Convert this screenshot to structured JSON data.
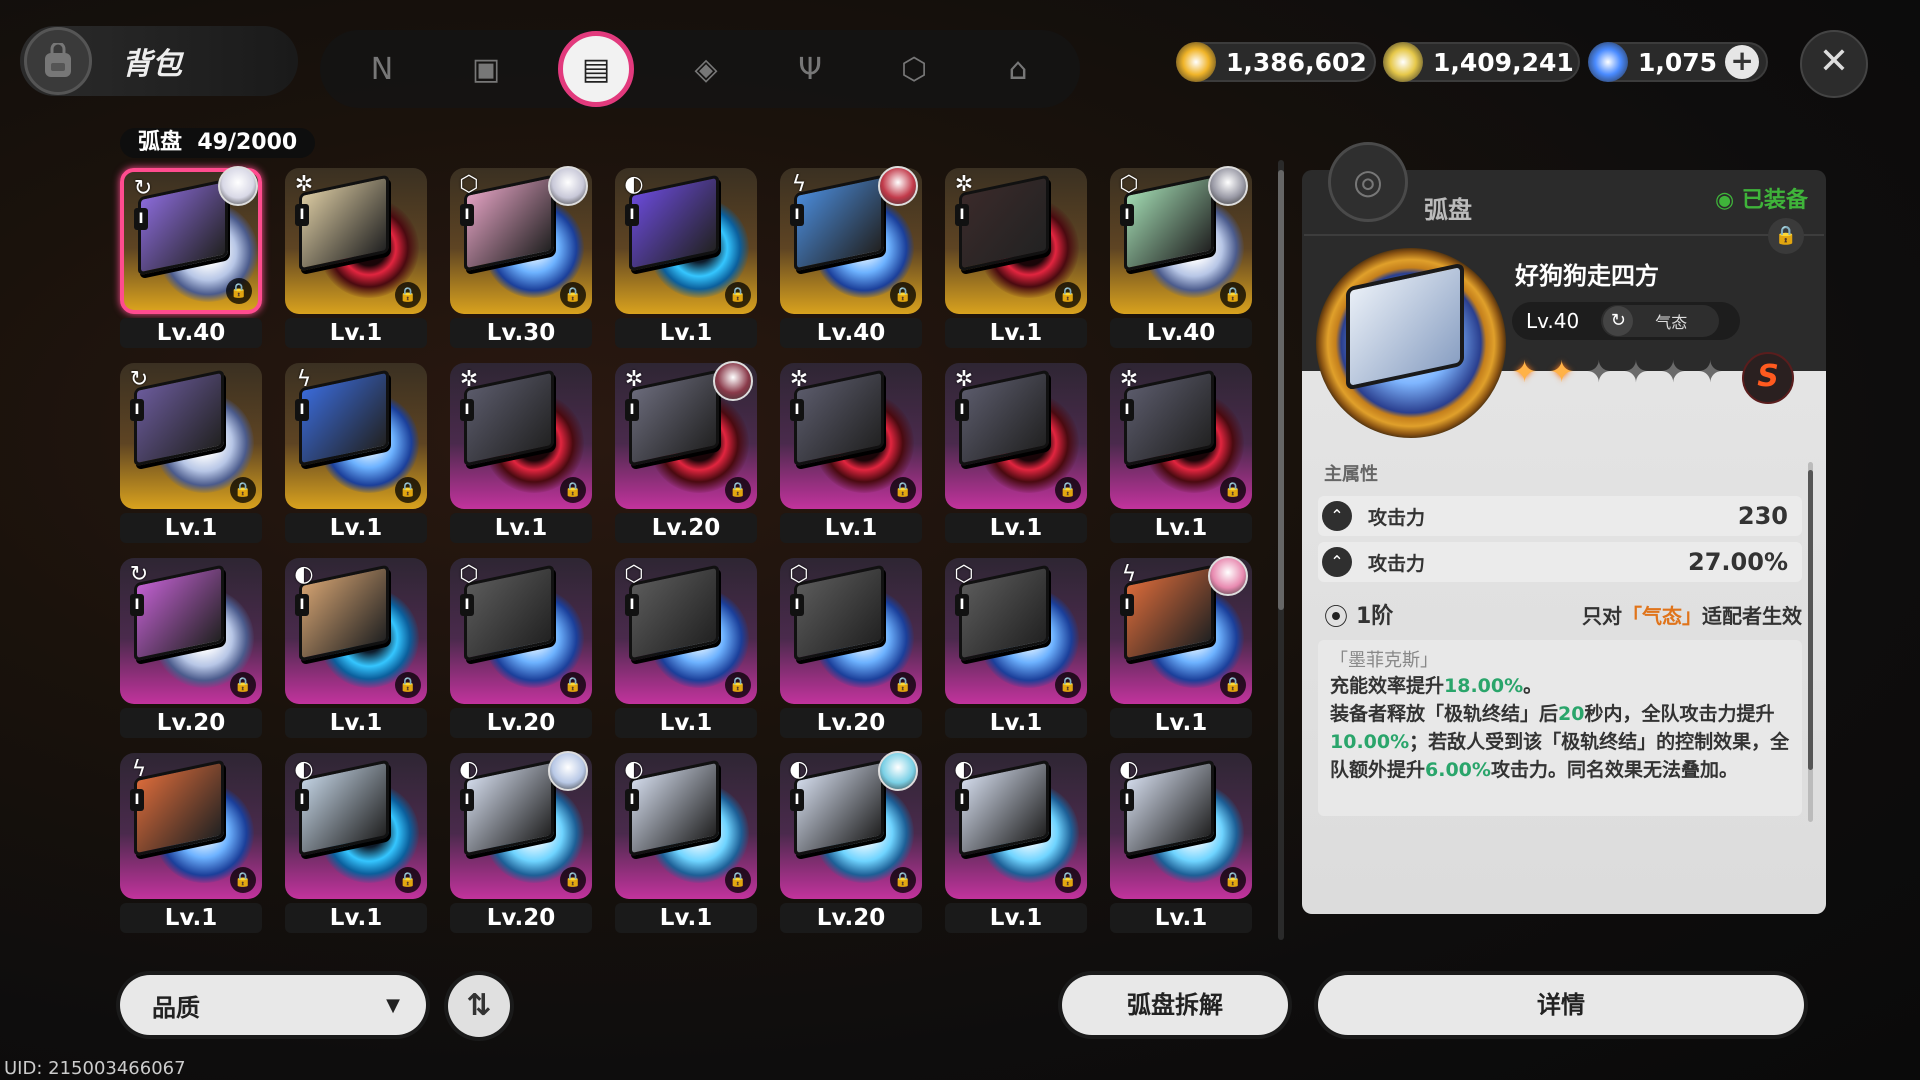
{
  "header": {
    "title": "背包",
    "tabs": [
      {
        "icon": "n-logo-icon",
        "glyph": "N"
      },
      {
        "icon": "device-icon",
        "glyph": "▣"
      },
      {
        "icon": "disc-card-icon",
        "glyph": "▤",
        "active": true
      },
      {
        "icon": "cube-icon",
        "glyph": "◈"
      },
      {
        "icon": "fork-knife-icon",
        "glyph": "Ψ"
      },
      {
        "icon": "package-icon",
        "glyph": "⬡"
      },
      {
        "icon": "home-icon",
        "glyph": "⌂"
      }
    ],
    "currencies": [
      {
        "name": "gold-coin-icon",
        "value": "1,386,602",
        "color": "#f0b429"
      },
      {
        "name": "ticket-icon",
        "value": "1,409,241",
        "color": "#e6c84a"
      },
      {
        "name": "crystal-icon",
        "value": "1,075",
        "color": "#4a8bff"
      }
    ],
    "close_label": "✕",
    "plus_label": "+"
  },
  "inventory": {
    "category": "弧盘",
    "count": "49/2000",
    "items": [
      {
        "frame": "gold",
        "disc": "white",
        "type": "↻",
        "avatar": "#d8d8e6",
        "level": "Lv.40",
        "selected": true
      },
      {
        "frame": "gold",
        "disc": "red",
        "type": "✲",
        "avatar": "",
        "level": "Lv.1"
      },
      {
        "frame": "gold",
        "disc": "blue",
        "type": "⬡",
        "avatar": "#c8c8d8",
        "level": "Lv.30"
      },
      {
        "frame": "gold",
        "disc": "cyan",
        "type": "◐",
        "avatar": "",
        "level": "Lv.1"
      },
      {
        "frame": "gold",
        "disc": "blue",
        "type": "ϟ",
        "avatar": "#c23a4a",
        "level": "Lv.40"
      },
      {
        "frame": "gold",
        "disc": "red",
        "type": "✲",
        "avatar": "",
        "level": "Lv.1"
      },
      {
        "frame": "gold",
        "disc": "white",
        "type": "⬡",
        "avatar": "#9a9aa6",
        "level": "Lv.40"
      },
      {
        "frame": "gold",
        "disc": "white",
        "type": "↻",
        "avatar": "",
        "level": "Lv.1"
      },
      {
        "frame": "gold",
        "disc": "blue",
        "type": "ϟ",
        "avatar": "",
        "level": "Lv.1"
      },
      {
        "frame": "purple",
        "disc": "red",
        "type": "✲",
        "avatar": "",
        "level": "Lv.1"
      },
      {
        "frame": "purple",
        "disc": "red",
        "type": "✲",
        "avatar": "#8a3a4a",
        "level": "Lv.20"
      },
      {
        "frame": "purple",
        "disc": "red",
        "type": "✲",
        "avatar": "",
        "level": "Lv.1"
      },
      {
        "frame": "purple",
        "disc": "red",
        "type": "✲",
        "avatar": "",
        "level": "Lv.1"
      },
      {
        "frame": "purple",
        "disc": "red",
        "type": "✲",
        "avatar": "",
        "level": "Lv.1"
      },
      {
        "frame": "purple",
        "disc": "white",
        "type": "↻",
        "avatar": "",
        "level": "Lv.20"
      },
      {
        "frame": "purple",
        "disc": "cyan",
        "type": "◐",
        "avatar": "",
        "level": "Lv.1"
      },
      {
        "frame": "purple",
        "disc": "blue",
        "type": "⬡",
        "avatar": "",
        "level": "Lv.20"
      },
      {
        "frame": "purple",
        "disc": "blue",
        "type": "⬡",
        "avatar": "",
        "level": "Lv.1"
      },
      {
        "frame": "purple",
        "disc": "blue",
        "type": "⬡",
        "avatar": "",
        "level": "Lv.20"
      },
      {
        "frame": "purple",
        "disc": "blue",
        "type": "⬡",
        "avatar": "",
        "level": "Lv.1"
      },
      {
        "frame": "purple",
        "disc": "blue",
        "type": "ϟ",
        "avatar": "#e88ab0",
        "level": "Lv.1"
      },
      {
        "frame": "purple",
        "disc": "blue",
        "type": "ϟ",
        "avatar": "",
        "level": "Lv.1"
      },
      {
        "frame": "purple",
        "disc": "cyan",
        "type": "◐",
        "avatar": "",
        "level": "Lv.1"
      },
      {
        "frame": "purple",
        "disc": "ice",
        "type": "◐",
        "avatar": "#b8c8e6",
        "level": "Lv.20"
      },
      {
        "frame": "purple",
        "disc": "ice",
        "type": "◐",
        "avatar": "",
        "level": "Lv.1"
      },
      {
        "frame": "purple",
        "disc": "ice",
        "type": "◐",
        "avatar": "#7ad0e6",
        "level": "Lv.20"
      },
      {
        "frame": "purple",
        "disc": "ice",
        "type": "◐",
        "avatar": "",
        "level": "Lv.1"
      },
      {
        "frame": "purple",
        "disc": "ice",
        "type": "◐",
        "avatar": "",
        "level": "Lv.1"
      }
    ]
  },
  "detail": {
    "section_title": "弧盘",
    "equipped_label": "◉ 已装备",
    "name": "好狗狗走四方",
    "level": "Lv.40",
    "attribute": "气态",
    "stars_on": 2,
    "stars_total": 7,
    "rarity": "S",
    "main_attr_label": "主属性",
    "stats": [
      {
        "name": "攻击力",
        "value": "230"
      },
      {
        "name": "攻击力",
        "value": "27.00%"
      }
    ],
    "tier": "1阶",
    "tier_cond_pre": "只对",
    "tier_cond_hl": "「气态」",
    "tier_cond_post": "适配者生效",
    "effect_name": "「墨菲克斯」",
    "effect_lines": [
      {
        "segments": [
          [
            "充能效率提升",
            ""
          ],
          [
            "18.00%",
            "g"
          ],
          [
            "。",
            ""
          ]
        ]
      },
      {
        "segments": [
          [
            "装备者释放「极轨终结」后",
            ""
          ],
          [
            "20",
            "g"
          ],
          [
            "秒内，全队攻击力提升",
            ""
          ],
          [
            "10.00%",
            "g"
          ],
          [
            "；若敌人受到该「极轨终结」的控制效果，全队额外提升",
            ""
          ],
          [
            "6.00%",
            "g"
          ],
          [
            "攻击力。同名效果无法叠加。",
            ""
          ]
        ]
      }
    ]
  },
  "bottom": {
    "filter_label": "品质",
    "sort_label": "⇅",
    "dismantle_label": "弧盘拆解",
    "detail_label": "详情",
    "uid": "UID: 215003466067"
  }
}
